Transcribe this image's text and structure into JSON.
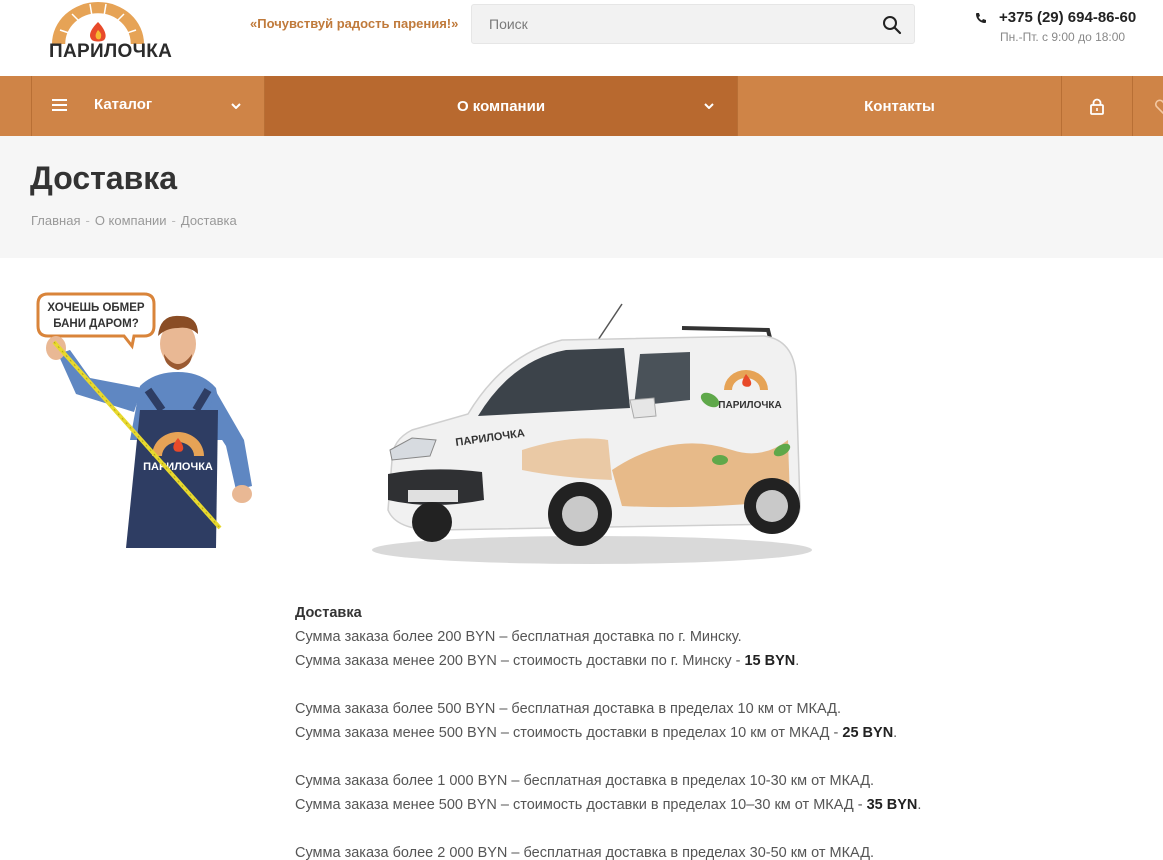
{
  "header": {
    "logo_text": "ПАРИЛОЧКА",
    "slogan": "«Почувствуй радость парения!»",
    "search_placeholder": "Поиск",
    "phone": "+375 (29) 694-86-60",
    "hours": "Пн.-Пт. с 9:00 до 18:00"
  },
  "nav": {
    "catalog": "Каталог",
    "about": "О компании",
    "contacts": "Контакты"
  },
  "page": {
    "title": "Доставка",
    "breadcrumb": [
      "Главная",
      "О компании",
      "Доставка"
    ]
  },
  "promo": {
    "bubble_line1": "ХОЧЕШЬ ОБМЕР",
    "bubble_line2": "БАНИ ДАРОМ?",
    "apron_text": "ПАРИЛОЧКА"
  },
  "van": {
    "brand_side": "ПАРИЛОЧКА",
    "brand_hood": "ПАРИЛОЧКА"
  },
  "delivery": {
    "heading": "Доставка",
    "lines": [
      {
        "text": "Сумма заказа более 200 BYN – бесплатная доставка по г. Минску.",
        "price": ""
      },
      {
        "text": "Сумма заказа менее 200 BYN – стоимость доставки по г. Минску - ",
        "price": "15 BYN"
      },
      {
        "text": "Сумма заказа более 500 BYN – бесплатная доставка в пределах 10 км от МКАД.",
        "price": ""
      },
      {
        "text": "Сумма заказа менее 500 BYN – стоимость доставки в пределах 10 км от МКАД - ",
        "price": "25 BYN"
      },
      {
        "text": "Сумма заказа более 1 000 BYN – бесплатная доставка в пределах 10-30 км от МКАД.",
        "price": ""
      },
      {
        "text": "Сумма заказа менее 500 BYN – стоимость доставки в пределах 10–30 км от МКАД - ",
        "price": "35 BYN"
      },
      {
        "text": "Сумма заказа более 2 000 BYN – бесплатная доставка в пределах 30-50 км от МКАД.",
        "price": ""
      }
    ]
  },
  "colors": {
    "nav": "#cf8447",
    "nav_active": "#b8692f",
    "slogan": "#c07a3b"
  }
}
